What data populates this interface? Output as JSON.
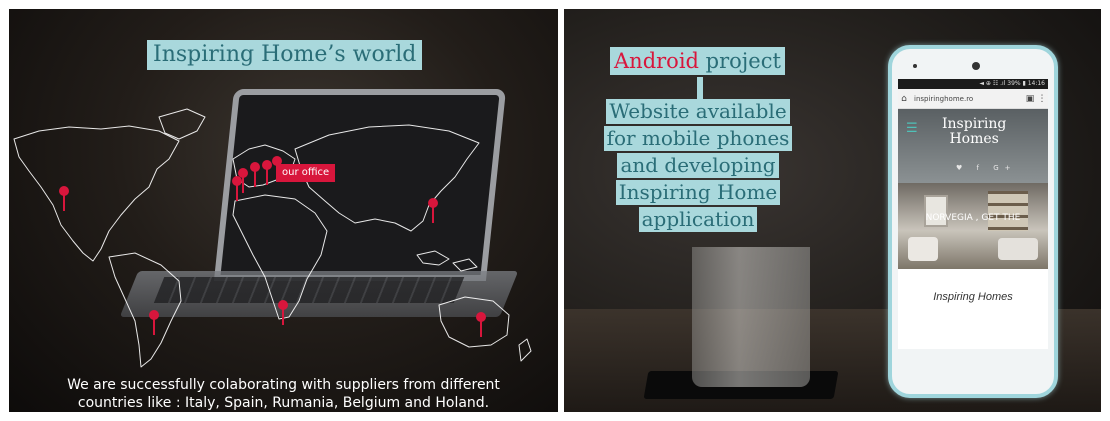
{
  "left": {
    "title": "Inspiring Home’s world",
    "office_label": "our office",
    "caption_line1": "We are successfully colaborating with suppliers from different",
    "caption_line2": "countries like : Italy, Spain, Rumania, Belgium and Holand.",
    "pin_color": "#d8163c"
  },
  "right": {
    "android_word": "Android",
    "project_word": " project",
    "description_lines": [
      "Website available",
      "for mobile phones",
      "and developing",
      "Inspiring Home",
      "application"
    ],
    "highlight_color": "#a9d8dc"
  },
  "phone": {
    "status": "◄ ⊕ ☷ .ıl 39% ▮ 14:16",
    "home_icon": "home-icon",
    "url": "inspiringhome.ro",
    "menu_icon": "menu-dots-icon",
    "logo_line1": "Inspiring",
    "logo_line2": "Homes",
    "social": "♥ f G+",
    "room_text": "NORVEGIA , GET THE",
    "footer_brand": "Inspiring Homes"
  }
}
